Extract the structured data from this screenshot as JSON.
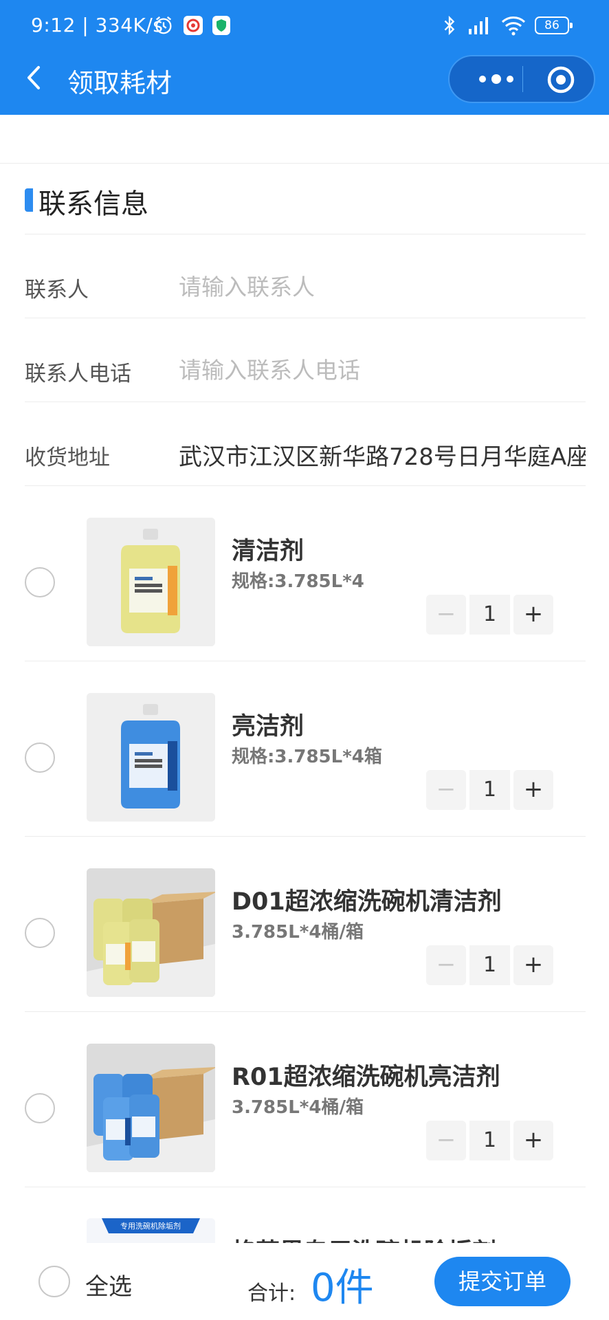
{
  "status_bar": {
    "time": "9:12 | 334K/s",
    "battery": "86"
  },
  "nav": {
    "title": "领取耗材"
  },
  "contact": {
    "section_title": "联系信息",
    "contact_label": "联系人",
    "contact_placeholder": "请输入联系人",
    "phone_label": "联系人电话",
    "phone_placeholder": "请输入联系人电话",
    "address_label": "收货地址",
    "address_value": "武汉市江汉区新华路728号日月华庭A座"
  },
  "products": [
    {
      "name": "清洁剂",
      "spec": "规格:3.785L*4",
      "qty": "1",
      "image": "yellow-bottle"
    },
    {
      "name": "亮洁剂",
      "spec": "规格:3.785L*4箱",
      "qty": "1",
      "image": "blue-bottle"
    },
    {
      "name": "D01超浓缩洗碗机清洁剂",
      "spec": "3.785L*4桶/箱",
      "qty": "1",
      "image": "yellow-bottles-with-box"
    },
    {
      "name": "R01超浓缩洗碗机亮洁剂",
      "spec": "3.785L*4桶/箱",
      "qty": "1",
      "image": "blue-bottles-with-box"
    },
    {
      "name": "格莱恩专用洗碗机除垢剂",
      "spec": "",
      "qty": "",
      "image": "descaler-box",
      "banner": "专用洗碗机除垢剂"
    }
  ],
  "stepper": {
    "minus": "−",
    "plus": "+"
  },
  "bottom": {
    "select_all": "全选",
    "total_label": "合计:",
    "total_value": "0件",
    "submit": "提交订单"
  },
  "colors": {
    "primary": "#1e87f0",
    "nav_capsule": "#1566c9"
  }
}
